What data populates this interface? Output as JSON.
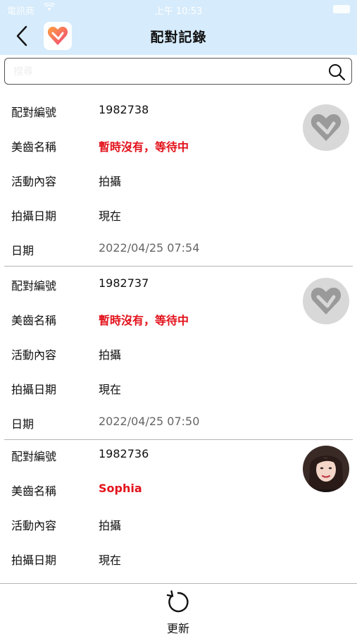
{
  "status_bar": {
    "carrier": "電訊商",
    "time": "上午 10:53"
  },
  "nav": {
    "title": "配對記錄",
    "logo_icon": "heart-logo-icon",
    "back_icon": "chevron-left-icon"
  },
  "search": {
    "value": "",
    "placeholder": "搜尋"
  },
  "labels": {
    "match_no": "配對編號",
    "beautician": "美齒名稱",
    "activity": "活動內容",
    "shoot_date": "拍攝日期",
    "date": "日期"
  },
  "records": [
    {
      "match_no": "1982738",
      "beautician": "暫時沒有，等待中",
      "activity": "拍攝",
      "shoot_date": "現在",
      "date": "2022/04/25 07:54",
      "avatar": "placeholder-heart"
    },
    {
      "match_no": "1982737",
      "beautician": "暫時沒有，等待中",
      "activity": "拍攝",
      "shoot_date": "現在",
      "date": "2022/04/25 07:50",
      "avatar": "placeholder-heart"
    },
    {
      "match_no": "1982736",
      "beautician": "Sophia",
      "activity": "拍攝",
      "shoot_date": "現在",
      "avatar": "user-photo"
    }
  ],
  "bottom": {
    "refresh_label": "更新",
    "refresh_icon": "refresh-icon"
  },
  "colors": {
    "header_bg": "#d6ebfb",
    "highlight_text": "#e3121b",
    "divider": "#b5b5b5",
    "brand_pink": "#f06292",
    "brand_orange": "#ffa040"
  }
}
